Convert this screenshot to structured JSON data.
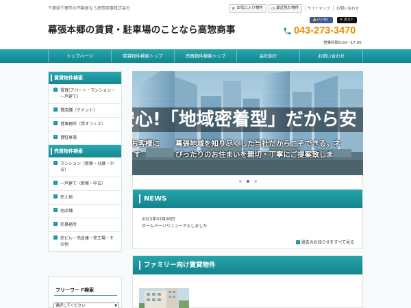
{
  "header": {
    "tagline": "千葉県千葉市の不動産なら高惣商事株式会社",
    "site_title": "幕張本郷の賃貸・駐車場のことなら高惣商事",
    "favorites_label": "お気に入り物件",
    "recent_label": "最近見た物件",
    "sitemap_label": "サイトマップ",
    "contact_link": "お問い合わせ",
    "like_label": "いいね！",
    "post_label": "ポスト",
    "phone": "043-273-3470",
    "hours": "営業時間9:00～17:00"
  },
  "nav": {
    "items": [
      "トップページ",
      "賃貸物件検索トップ",
      "売買物件検索トップ",
      "会社紹介",
      "お問い合わせ"
    ]
  },
  "sidebar": {
    "rental_heading": "賃貸物件検索",
    "rental_items": [
      "賃貸(アパート・マンション・一戸建て)",
      "貸店舗（テナント）",
      "貸事務所（貸オフィス）",
      "貸駐車場"
    ],
    "sale_heading": "売買物件検索",
    "sale_items": [
      "マンション（新築・分譲・中古）",
      "一戸建て（新築・中古）",
      "売土地",
      "売店舗",
      "売事務所",
      "売ビル・売倉庫・売工場・その他"
    ],
    "freeword_heading": "フリーワード検索",
    "select_value": "選択してください"
  },
  "slider": {
    "headline": "安心!「地域密着型」だから安",
    "sub_line1": "幕張地域を知り尽くした当社だからこそできる。ネ",
    "sub_line2": "ぴったりのお住まいを親切・丁寧にご提案致しま",
    "left_line1": "お客様に",
    "left_line2": "す",
    "active_dot": 1
  },
  "news": {
    "heading": "NEWS",
    "date": "2023年03月06日",
    "text": "ホームページリニューアルしました",
    "more_label": "過去のお知らせをすべて見る"
  },
  "family": {
    "heading": "ファミリー向け賃貸物件"
  },
  "colors": {
    "accent": "#17939c",
    "phone": "#f08a00"
  }
}
